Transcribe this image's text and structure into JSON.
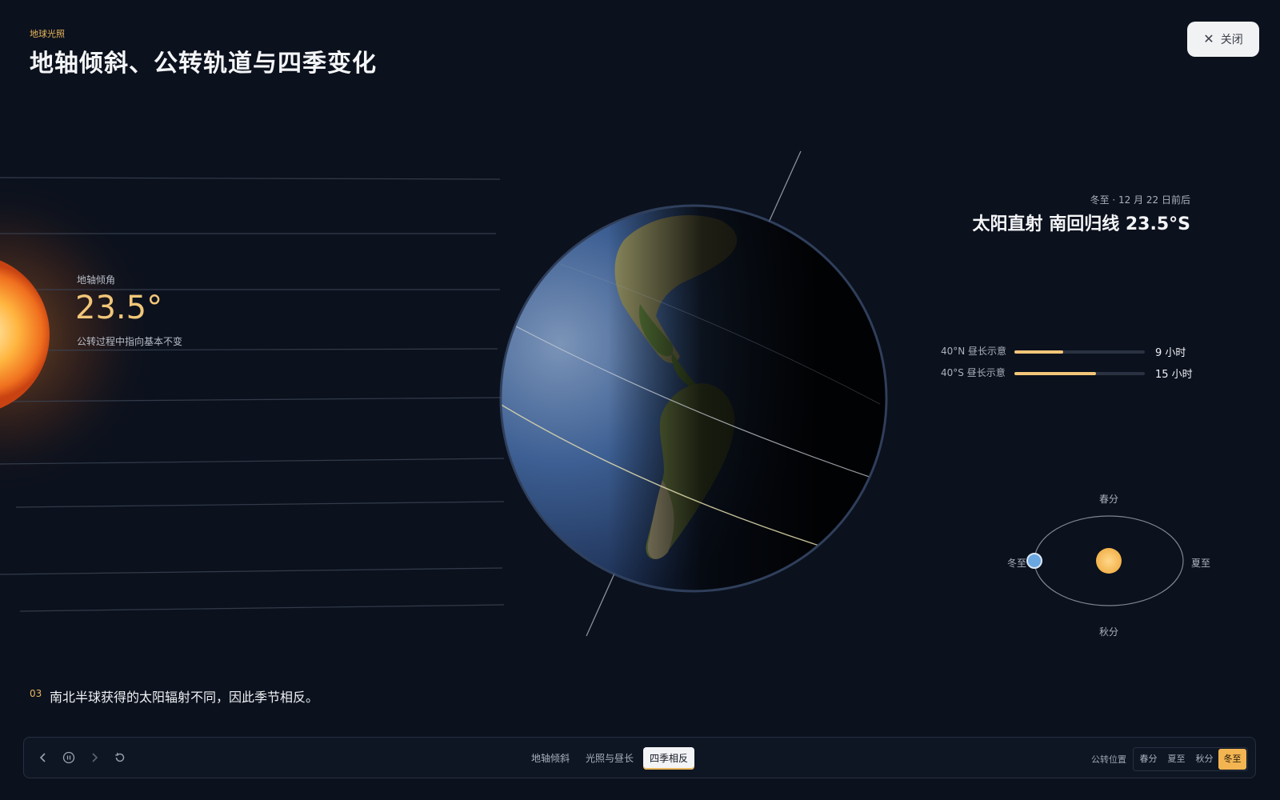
{
  "header": {
    "eyebrow": "地球光照",
    "title": "地轴倾斜、公转轨道与四季变化"
  },
  "close_button": {
    "label": "关闭"
  },
  "tilt": {
    "label": "地轴倾角",
    "value": "23.5°",
    "description": "公转过程中指向基本不变"
  },
  "info": {
    "date": "冬至 · 12 月 22 日前后",
    "headline": "太阳直射 南回归线 23.5°S",
    "daylight": [
      {
        "label": "40°N 昼长示意",
        "value": "9 小时",
        "fraction": 0.375
      },
      {
        "label": "40°S 昼长示意",
        "value": "15 小时",
        "fraction": 0.625
      }
    ]
  },
  "orbit": {
    "top": "春分",
    "right": "夏至",
    "bottom": "秋分",
    "left": "冬至"
  },
  "step": {
    "number": "03",
    "text": "南北半球获得的太阳辐射不同，因此季节相反。"
  },
  "toolbar": {
    "chapters": [
      "地轴倾斜",
      "光照与昼长",
      "四季相反"
    ],
    "active_chapter": 2,
    "season_label": "公转位置",
    "seasons": [
      "春分",
      "夏至",
      "秋分",
      "冬至"
    ],
    "active_season": 3
  },
  "colors": {
    "accent": "#f2b552",
    "background": "#0b111d",
    "earth_marker": "#6aa6e0"
  }
}
